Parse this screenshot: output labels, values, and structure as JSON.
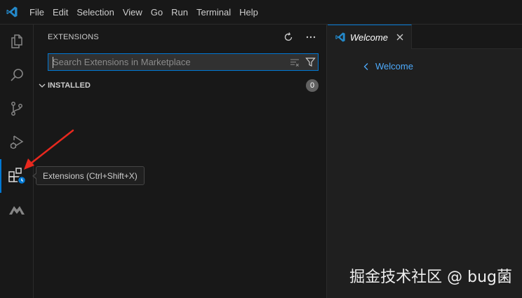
{
  "titlebar": {
    "logo_icon": "vscode-logo-icon",
    "menu": [
      "File",
      "Edit",
      "Selection",
      "View",
      "Go",
      "Run",
      "Terminal",
      "Help"
    ]
  },
  "activity_bar": {
    "items": [
      {
        "name": "explorer",
        "icon": "files-icon"
      },
      {
        "name": "search",
        "icon": "search-icon"
      },
      {
        "name": "source-control",
        "icon": "source-control-icon"
      },
      {
        "name": "run-and-debug",
        "icon": "run-debug-icon"
      },
      {
        "name": "extensions",
        "icon": "extensions-icon",
        "active": true
      },
      {
        "name": "codemaker",
        "icon": "m-logo-icon"
      }
    ],
    "tooltip": "Extensions (Ctrl+Shift+X)"
  },
  "sidebar": {
    "title": "EXTENSIONS",
    "search": {
      "placeholder": "Search Extensions in Marketplace",
      "value": ""
    },
    "section": {
      "title": "INSTALLED",
      "count": "0"
    }
  },
  "editor": {
    "tab": {
      "label": "Welcome"
    },
    "back_link": "Welcome"
  },
  "watermark": "掘金技术社区 @ bug菌",
  "colors": {
    "accent": "#0078d4",
    "link": "#4daafc",
    "annotation_arrow": "#e8281e"
  }
}
